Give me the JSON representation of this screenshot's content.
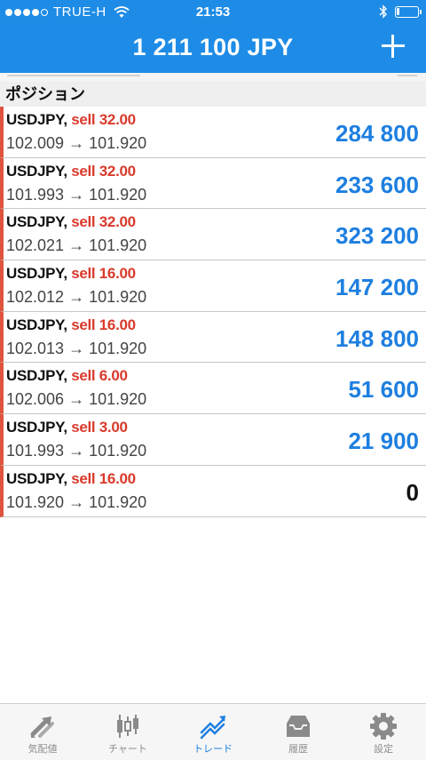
{
  "status_bar": {
    "carrier": "TRUE-H",
    "time": "21:53",
    "signal_bars_filled": 4,
    "signal_bars_total": 5,
    "icons": [
      "signal-dots-icon",
      "wifi-icon",
      "bluetooth-icon",
      "battery-icon"
    ]
  },
  "header": {
    "title": "1 211 100 JPY",
    "add_icon": "plus-icon",
    "background": "#1e8ce6"
  },
  "section": {
    "title": "ポジション"
  },
  "positions": [
    {
      "symbol": "USDJPY,",
      "side": "sell 32.00",
      "prices": "102.009 → 101.920",
      "profit": "284 800"
    },
    {
      "symbol": "USDJPY,",
      "side": "sell 32.00",
      "prices": "101.993 → 101.920",
      "profit": "233 600"
    },
    {
      "symbol": "USDJPY,",
      "side": "sell 32.00",
      "prices": "102.021 → 101.920",
      "profit": "323 200"
    },
    {
      "symbol": "USDJPY,",
      "side": "sell 16.00",
      "prices": "102.012 → 101.920",
      "profit": "147 200"
    },
    {
      "symbol": "USDJPY,",
      "side": "sell 16.00",
      "prices": "102.013 → 101.920",
      "profit": "148 800"
    },
    {
      "symbol": "USDJPY,",
      "side": "sell 6.00",
      "prices": "102.006 → 101.920",
      "profit": "51 600"
    },
    {
      "symbol": "USDJPY,",
      "side": "sell 3.00",
      "prices": "101.993 → 101.920",
      "profit": "21 900"
    },
    {
      "symbol": "USDJPY,",
      "side": "sell 16.00",
      "prices": "101.920 → 101.920",
      "profit": "0"
    }
  ],
  "tabbar": {
    "tabs": [
      {
        "label": "気配値",
        "icon": "quotes-arrows-icon",
        "active": false
      },
      {
        "label": "チャート",
        "icon": "candlestick-chart-icon",
        "active": false
      },
      {
        "label": "トレード",
        "icon": "trade-trend-icon",
        "active": true
      },
      {
        "label": "履歴",
        "icon": "history-tray-icon",
        "active": false
      },
      {
        "label": "設定",
        "icon": "settings-gear-icon",
        "active": false
      }
    ]
  },
  "colors": {
    "accent": "#1e7fe0",
    "sell": "#d93a2b",
    "row_marker": "#e0533e",
    "inactive_tab": "#8e8e8e"
  }
}
